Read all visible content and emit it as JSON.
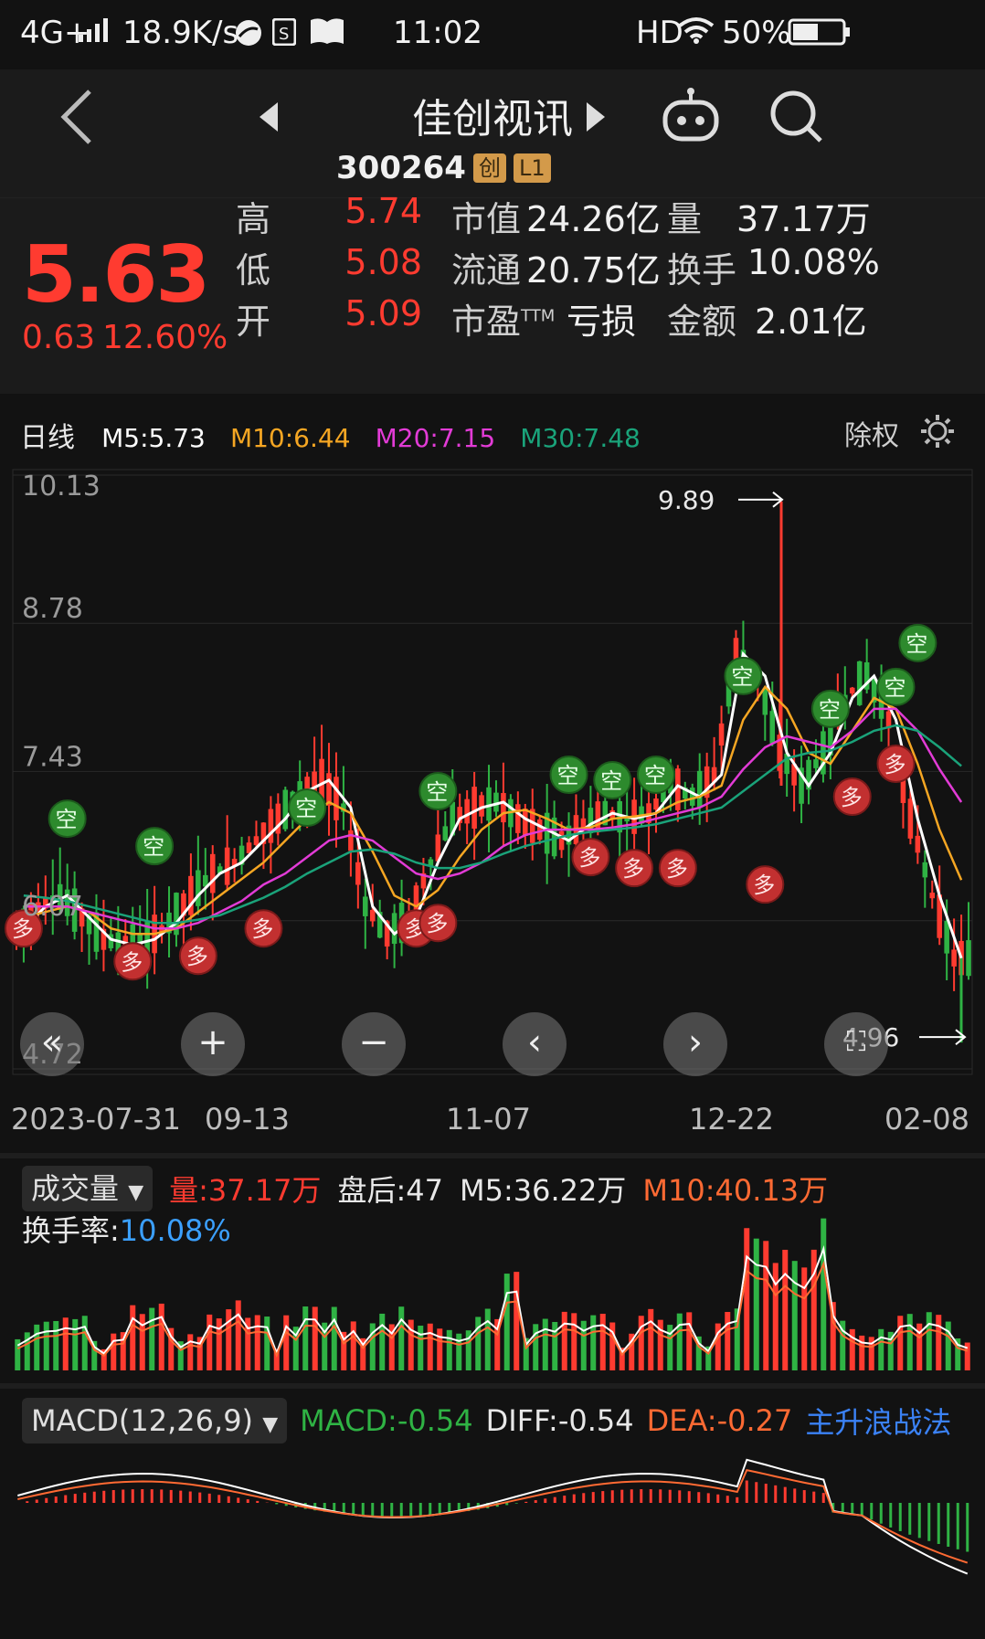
{
  "status_bar": {
    "network": "4G+",
    "speed": "18.9K/s",
    "time": "11:02",
    "hd": "HD",
    "battery": "50%"
  },
  "header": {
    "stock_name": "佳创视讯",
    "stock_code": "300264",
    "tag_board": "创",
    "tag_level": "L1"
  },
  "quote": {
    "price": "5.63",
    "change": "0.63",
    "change_pct": "12.60%",
    "rows": [
      {
        "l1": "高",
        "v1": "5.74",
        "l2": "市值",
        "v2": "24.26亿",
        "l3": "量",
        "v3": "37.17万"
      },
      {
        "l1": "低",
        "v1": "5.08",
        "l2": "流通",
        "v2": "20.75亿",
        "l3": "换手",
        "v3": "10.08%"
      },
      {
        "l1": "开",
        "v1": "5.09",
        "l2": "市盈",
        "l2_sup": "TTM",
        "v2": "亏损",
        "l3": "金额",
        "v3": "2.01亿"
      }
    ]
  },
  "kline": {
    "period": "日线",
    "ma5": "M5:5.73",
    "ma10": "M10:6.44",
    "ma20": "M20:7.15",
    "ma30": "M30:7.48",
    "adjust": "除权",
    "y_labels": [
      "10.13",
      "8.78",
      "7.43",
      "6.07",
      "4.72"
    ],
    "max_label": "9.89",
    "min_label": "4.96",
    "dates": [
      "2023-07-31",
      "09-13",
      "11-07",
      "12-22",
      "02-08"
    ],
    "signal_buy": "多",
    "signal_sell": "空"
  },
  "volume": {
    "indicator": "成交量",
    "vol": "量:37.17万",
    "after": "盘后:47",
    "m5": "M5:36.22万",
    "m10": "M10:40.13万",
    "turnover_label": "换手率:",
    "turnover": "10.08%"
  },
  "macd": {
    "indicator": "MACD(12,26,9)",
    "macd": "MACD:-0.54",
    "diff": "DIFF:-0.54",
    "dea": "DEA:-0.27",
    "strategy": "主升浪战法"
  },
  "colors": {
    "up": "#ff3b30",
    "down": "#2fb344",
    "ma5": "#ffffff",
    "ma10": "#f5a623",
    "ma20": "#e23bd6",
    "ma30": "#1aa37a"
  },
  "chart_data": {
    "type": "candlestick",
    "title": "",
    "ylim": [
      4.72,
      10.13
    ],
    "x_labels": [
      "2023-07-31",
      "09-13",
      "11-07",
      "12-22",
      "02-08"
    ],
    "series": [
      {
        "name": "M5",
        "values": [
          6.0,
          6.2,
          6.3,
          6.1,
          5.9,
          5.85,
          5.9,
          6.05,
          6.3,
          6.5,
          6.6,
          6.8,
          7.0,
          7.25,
          7.35,
          7.1,
          6.2,
          5.95,
          6.1,
          6.6,
          7.0,
          7.1,
          7.15,
          7.0,
          6.9,
          6.8,
          6.95,
          7.05,
          7.0,
          7.05,
          7.3,
          7.2,
          7.4,
          8.5,
          8.3,
          7.6,
          7.3,
          7.6,
          8.1,
          8.3,
          7.9,
          7.0,
          6.3,
          5.73
        ]
      },
      {
        "name": "M10",
        "values": [
          6.1,
          6.15,
          6.2,
          6.15,
          6.0,
          5.95,
          5.95,
          6.0,
          6.15,
          6.3,
          6.45,
          6.6,
          6.8,
          7.0,
          7.15,
          7.05,
          6.7,
          6.3,
          6.2,
          6.35,
          6.65,
          6.9,
          7.05,
          7.08,
          7.0,
          6.9,
          6.92,
          7.0,
          7.02,
          7.05,
          7.15,
          7.2,
          7.3,
          7.9,
          8.2,
          8.0,
          7.6,
          7.5,
          7.8,
          8.1,
          8.0,
          7.5,
          6.9,
          6.44
        ]
      },
      {
        "name": "M20",
        "values": [
          6.2,
          6.2,
          6.2,
          6.15,
          6.1,
          6.05,
          6.0,
          6.0,
          6.05,
          6.15,
          6.25,
          6.4,
          6.5,
          6.65,
          6.8,
          6.85,
          6.8,
          6.65,
          6.5,
          6.45,
          6.5,
          6.6,
          6.75,
          6.85,
          6.9,
          6.9,
          6.9,
          6.92,
          6.95,
          7.0,
          7.05,
          7.1,
          7.2,
          7.45,
          7.65,
          7.75,
          7.7,
          7.65,
          7.8,
          8.0,
          8.0,
          7.8,
          7.45,
          7.15
        ]
      },
      {
        "name": "M30",
        "values": [
          6.3,
          6.28,
          6.25,
          6.2,
          6.15,
          6.1,
          6.05,
          6.05,
          6.08,
          6.12,
          6.2,
          6.28,
          6.38,
          6.5,
          6.6,
          6.7,
          6.72,
          6.68,
          6.6,
          6.55,
          6.55,
          6.6,
          6.68,
          6.75,
          6.8,
          6.85,
          6.88,
          6.9,
          6.92,
          6.95,
          7.0,
          7.05,
          7.1,
          7.25,
          7.4,
          7.55,
          7.6,
          7.62,
          7.7,
          7.8,
          7.85,
          7.8,
          7.65,
          7.48
        ]
      }
    ]
  }
}
